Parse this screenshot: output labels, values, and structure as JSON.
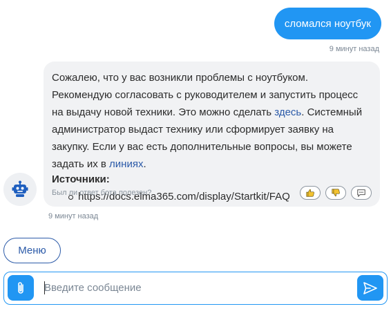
{
  "colors": {
    "accent": "#2196f3",
    "link": "#2b5aa8",
    "bubble_bg": "#f1f2f4",
    "muted": "#7b8794"
  },
  "user_message": {
    "text": "сломался ноутбук",
    "time": "9 минут назад"
  },
  "bot_message": {
    "avatar_icon": "robot-icon",
    "text_part1": "Сожалею, что у вас возникли проблемы с ноутбуком. Рекомендую согласовать с руководителем и запустить процесс на выдачу новой техники. Это можно сделать ",
    "link1": "здесь",
    "text_part2": ". Системный администратор выдаст технику или сформирует заявку на закупку. Если у вас есть дополнительные вопросы, вы можете задать их в ",
    "link2": "линиях",
    "text_part3": ".",
    "sources_title": "Источники:",
    "sources": [
      "https://docs.elma365.com/display/Startkit/FAQ"
    ],
    "feedback_question": "Был ли ответ бота полезен?",
    "feedback_icons": [
      "thumbs-up-icon",
      "thumbs-down-icon",
      "comment-icon"
    ],
    "time": "9 минут назад"
  },
  "menu": {
    "label": "Меню"
  },
  "composer": {
    "placeholder": "Введите сообщение",
    "attach_icon": "paperclip-icon",
    "send_icon": "send-icon"
  }
}
